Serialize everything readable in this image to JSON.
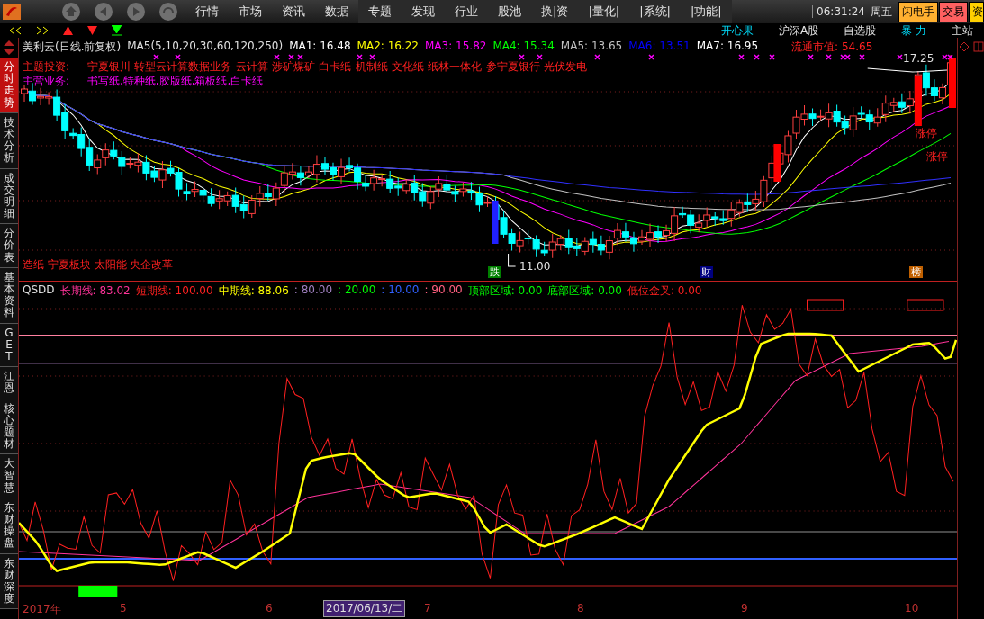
{
  "top_bar": {
    "menu": [
      {
        "label": "行情"
      },
      {
        "label": "市场"
      },
      {
        "label": "资讯"
      },
      {
        "label": "数据"
      },
      {
        "label": "专题"
      },
      {
        "label": "发现"
      },
      {
        "label": "行业"
      },
      {
        "label": "股池"
      },
      {
        "label": "换|资"
      },
      {
        "label": "|量化|"
      },
      {
        "label": "|系统|"
      },
      {
        "label": "|功能|"
      }
    ],
    "time": "06:31:24",
    "weekday": "周五",
    "buttons": [
      {
        "label": "闪电手",
        "kind": "flash"
      },
      {
        "label": "交易",
        "kind": "trade"
      },
      {
        "label": "资",
        "kind": "more"
      }
    ]
  },
  "toolbar": {
    "links": [
      {
        "label": "开心果",
        "highlighted": true
      },
      {
        "label": "沪深A股",
        "highlighted": false
      },
      {
        "label": "自选股",
        "highlighted": false
      },
      {
        "label": "暴 力",
        "highlighted": true
      },
      {
        "label": "主站",
        "highlighted": false
      }
    ]
  },
  "sidebar": {
    "tabs": [
      {
        "label": "分时走势",
        "selected": true
      },
      {
        "label": "技术分析",
        "selected": false
      },
      {
        "label": "成交明细",
        "selected": false
      },
      {
        "label": "分价表",
        "selected": false
      },
      {
        "label": "基本资料",
        "selected": false
      },
      {
        "label": "GET",
        "selected": false
      },
      {
        "label": "江恩",
        "selected": false
      },
      {
        "label": "核心题材",
        "selected": false
      },
      {
        "label": "大智慧",
        "selected": false
      },
      {
        "label": "东财操盘",
        "selected": false
      },
      {
        "label": "东财深度",
        "selected": false
      }
    ]
  },
  "price_chart": {
    "title": "美利云(日线.前复权)",
    "ma_params": "MA5(5,10,20,30,60,120,250)",
    "ma_values": [
      {
        "label": "MA1: 16.48",
        "color": "#ffffff"
      },
      {
        "label": "MA2: 16.22",
        "color": "#ffff00"
      },
      {
        "label": "MA3: 15.82",
        "color": "#ff00ff"
      },
      {
        "label": "MA4: 15.34",
        "color": "#00ff00"
      },
      {
        "label": "MA5: 13.65",
        "color": "#c0c0c0"
      },
      {
        "label": "MA6: 13.51",
        "color": "#0000ff"
      },
      {
        "label": "MA7: 16.95",
        "color": "#ffffff"
      }
    ],
    "market_cap": "流通市值: 54.65",
    "theme": {
      "label": "主题投资:",
      "text": "宁夏银川-转型云计算数据业务-云计算-涉矿煤矿-白卡纸-机制纸-文化纸-纸林一体化-参宁夏银行-光伏发电"
    },
    "business": {
      "label": "主营业务:",
      "text": "书写纸,特种纸,胶版纸,箱板纸,白卡纸"
    },
    "concepts": "造纸 宁夏板块 太阳能 央企改革",
    "high_label": "17.25",
    "low_label": "11.00",
    "limit_up_labels": [
      "涨停",
      "涨停"
    ],
    "event_tags": [
      {
        "label": "跌",
        "color": "#008000"
      },
      {
        "label": "财",
        "color": "#000080"
      },
      {
        "label": "榜",
        "color": "#c06000"
      }
    ]
  },
  "indicator_chart": {
    "name": "QSDD",
    "values": [
      {
        "label": "长期线: 83.02",
        "color": "#ff3399"
      },
      {
        "label": "短期线: 100.00",
        "color": "#ff2020"
      },
      {
        "label": "中期线: 88.06",
        "color": "#ffff00"
      },
      {
        "label": ": 80.00",
        "color": "#a080c0"
      },
      {
        "label": ": 20.00",
        "color": "#00ff00"
      },
      {
        "label": ": 10.00",
        "color": "#3060ff"
      },
      {
        "label": ": 90.00",
        "color": "#ff6080"
      },
      {
        "label": "顶部区域: 0.00",
        "color": "#00ff00"
      },
      {
        "label": "底部区域: 0.00",
        "color": "#00ff00"
      },
      {
        "label": "低位金叉: 0.00",
        "color": "#ff2020"
      }
    ]
  },
  "time_axis": {
    "labels": [
      {
        "label": "2017年",
        "selected": false
      },
      {
        "label": "5",
        "selected": false
      },
      {
        "label": "6",
        "selected": false
      },
      {
        "label": "2017/06/13/二",
        "selected": true
      },
      {
        "label": "7",
        "selected": false
      },
      {
        "label": "8",
        "selected": false
      },
      {
        "label": "9",
        "selected": false
      },
      {
        "label": "10",
        "selected": false
      }
    ]
  }
}
